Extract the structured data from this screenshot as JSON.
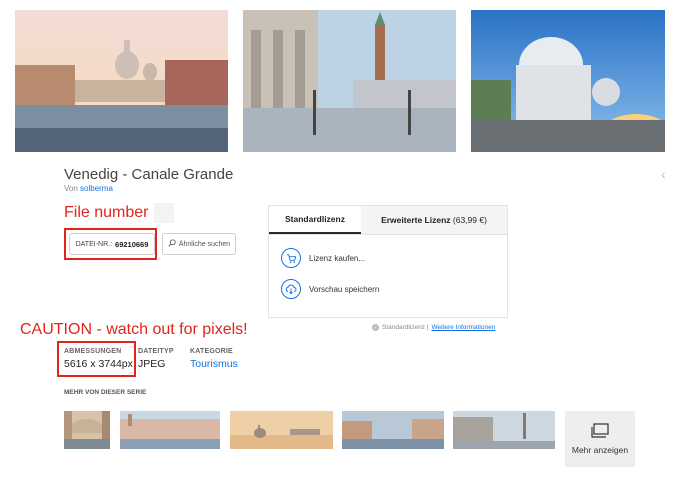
{
  "asset": {
    "title": "Venedig - Canale Grande",
    "by_prefix": "Von ",
    "author": "solberma"
  },
  "annotations": {
    "file_number": "File number",
    "caution": "CAUTION - watch out for pixels!"
  },
  "file": {
    "label": "DATEI-NR.:",
    "number": "69210669",
    "similar_label": "Ähnliche suchen"
  },
  "license": {
    "tab_standard": "Standardlizenz",
    "tab_extended": "Erweiterte Lizenz",
    "tab_extended_price": "(63,99 €)",
    "buy_label": "Lizenz kaufen...",
    "save_preview_label": "Vorschau speichern",
    "note": "Standardlizenz |",
    "more_info": "Weitere Informationen"
  },
  "meta": {
    "dimensions_label": "ABMESSUNGEN",
    "dimensions_value": "5616 x 3744px",
    "filetype_label": "DATEITYP",
    "filetype_value": "JPEG",
    "category_label": "KATEGORIE",
    "category_value": "Tourismus"
  },
  "series": {
    "heading": "MEHR VON DIESER SERIE",
    "more_label": "Mehr anzeigen"
  },
  "colors": {
    "accent": "#1473e6",
    "annotation": "#e1251b"
  }
}
